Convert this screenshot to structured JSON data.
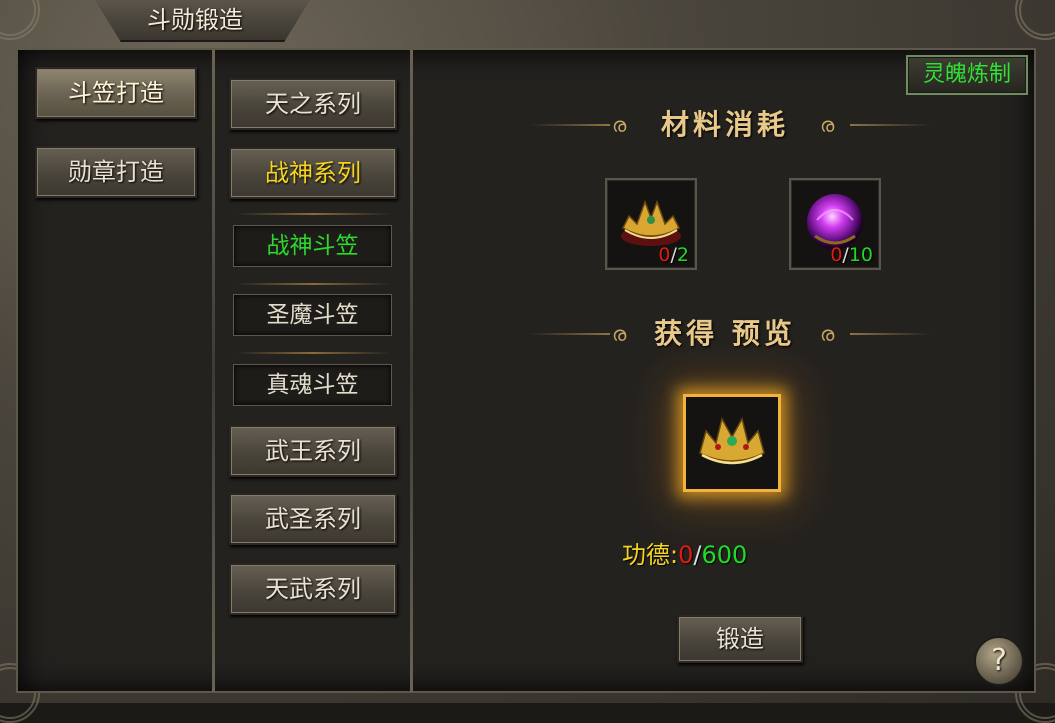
{
  "window": {
    "title": "斗勋锻造"
  },
  "left_tabs": [
    {
      "label": "斗笠打造"
    },
    {
      "label": "勋章打造"
    }
  ],
  "series": [
    {
      "label": "天之系列"
    },
    {
      "label": "战神系列"
    },
    {
      "label": "武王系列"
    },
    {
      "label": "武圣系列"
    },
    {
      "label": "天武系列"
    }
  ],
  "sub_items": [
    {
      "label": "战神斗笠"
    },
    {
      "label": "圣魔斗笠"
    },
    {
      "label": "真魂斗笠"
    }
  ],
  "soul_refine_label": "灵魄炼制",
  "materials_heading": "材料消耗",
  "materials": [
    {
      "icon": "crown-material-icon",
      "have": "0",
      "sep": "/",
      "need": "2"
    },
    {
      "icon": "purple-orb-icon",
      "have": "0",
      "sep": "/",
      "need": "10"
    }
  ],
  "preview_heading": "获得 预览",
  "preview_item": {
    "icon": "golden-crown-icon"
  },
  "merit": {
    "label": "功德:",
    "have": "0",
    "sep": "/",
    "need": "600"
  },
  "forge_label": "锻造",
  "help_label": "?",
  "colors": {
    "selected_green": "#22d828",
    "shortfall_red": "#e11a12",
    "merit_yellow": "#f5d421",
    "heading_gold": "#e9c98a"
  }
}
